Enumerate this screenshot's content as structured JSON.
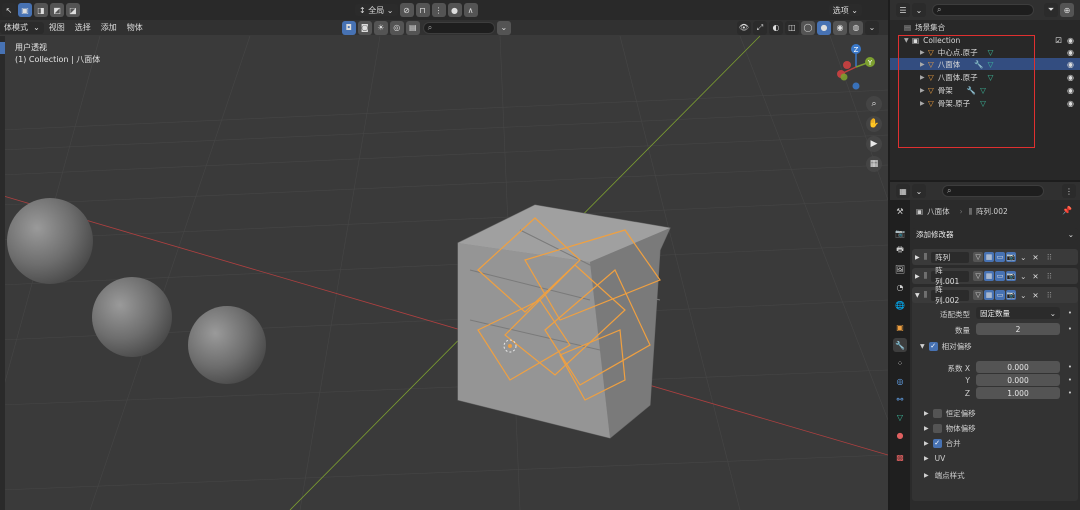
{
  "viewport": {
    "mode_label": "体模式",
    "menus": [
      "视图",
      "选择",
      "添加",
      "物体"
    ],
    "orientation_label": "全局",
    "options_label": "选项",
    "overlay_line1": "用户透视",
    "overlay_line2": "(1) Collection | 八面体",
    "gizmo": {
      "z": "Z",
      "y": "Y",
      "x": "X"
    }
  },
  "outliner": {
    "root_label": "场景集合",
    "collection_label": "Collection",
    "items": [
      {
        "label": "中心点.原子"
      },
      {
        "label": "八面体"
      },
      {
        "label": "八面体.原子"
      },
      {
        "label": "骨架"
      },
      {
        "label": "骨架.原子"
      }
    ]
  },
  "properties": {
    "object_name": "八面体",
    "modifier_path": "阵列.002",
    "add_modifier_label": "添加修改器",
    "modifiers": [
      {
        "name": "阵列"
      },
      {
        "name": "阵列.001"
      },
      {
        "name": "阵列.002"
      }
    ],
    "fit_type_label": "适配类型",
    "fit_type_value": "固定数量",
    "count_label": "数量",
    "count_value": "2",
    "relative_offset_label": "相对偏移",
    "factor_x_label": "系数 X",
    "factor_y_label": "Y",
    "factor_z_label": "Z",
    "factor_x": "0.000",
    "factor_y": "0.000",
    "factor_z": "1.000",
    "constant_offset_label": "恒定偏移",
    "object_offset_label": "物体偏移",
    "merge_label": "合并",
    "uv_label": "UV",
    "caps_label": "端点样式"
  },
  "colors": {
    "selection_orange": "#f0a040",
    "outliner_selected": "#334d80",
    "annotation_red": "#e03030",
    "x_axis_red": "#b04040",
    "y_axis_green": "#7da030",
    "active_blue": "#4772b3"
  }
}
